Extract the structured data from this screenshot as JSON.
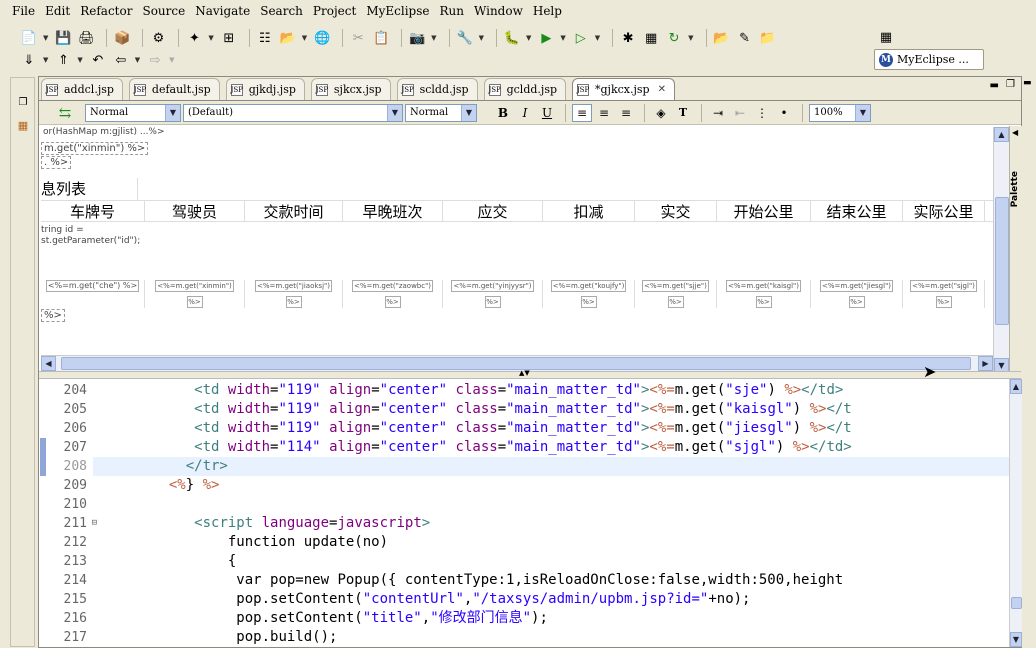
{
  "menu": [
    "File",
    "Edit",
    "Refactor",
    "Source",
    "Navigate",
    "Search",
    "Project",
    "MyEclipse",
    "Run",
    "Window",
    "Help"
  ],
  "perspective": {
    "label": "MyEclipse ...",
    "icon": "myeclipse-icon"
  },
  "tabs": [
    {
      "label": "addcl.jsp",
      "active": false
    },
    {
      "label": "default.jsp",
      "active": false
    },
    {
      "label": "gjkdj.jsp",
      "active": false
    },
    {
      "label": "sjkcx.jsp",
      "active": false
    },
    {
      "label": "scldd.jsp",
      "active": false
    },
    {
      "label": "gcldd.jsp",
      "active": false
    },
    {
      "label": "*gjkcx.jsp",
      "active": true
    }
  ],
  "format": {
    "paragraph": "Normal",
    "font": "(Default)",
    "size": "Normal",
    "zoom": "100%",
    "bold": "B",
    "italic": "I",
    "underline": "U"
  },
  "design": {
    "frag_top": "or(HashMap m:gjlist) ...%>",
    "frag_mget": "m.get(\"xinmin\") %>",
    "frag_pct": ". %>",
    "title": "息列表",
    "headers": [
      "车牌号",
      "驾驶员",
      "交款时间",
      "早晚班次",
      "应交",
      "扣减",
      "实交",
      "开始公里",
      "结束公里",
      "实际公里"
    ],
    "frag_string": "tring id =",
    "frag_param": "st.getParameter(\"id\");",
    "che_cell": "<%=m.get(\"che\") %>",
    "cells": [
      "<%=m.get(\"xinmin\")",
      "<%=m.get(\"jiaoksj\")",
      "<%=m.get(\"zaowbc\")",
      "<%=m.get(\"yinjyysr\")",
      "<%=m.get(\"koujfy\")",
      "<%=m.get(\"sjje\")",
      "<%=m.get(\"kaisgl\")",
      "<%=m.get(\"jiesgl\")",
      "<%=m.get(\"sjgl\")"
    ],
    "cell_close": "%>",
    "frag_bottom": "%>",
    "palette_label": "Palette"
  },
  "source": {
    "line_numbers": [
      "204",
      "205",
      "206",
      "207",
      "208",
      "209",
      "210",
      "211",
      "212",
      "213",
      "214",
      "215",
      "216",
      "217"
    ],
    "current_line": "208",
    "fold_line": "211",
    "lines": [
      {
        "indent": "            ",
        "parts": [
          [
            "tag",
            "<td "
          ],
          [
            "attr",
            "width"
          ],
          [
            "kw",
            "="
          ],
          [
            "str",
            "\"119\""
          ],
          [
            "kw",
            " "
          ],
          [
            "attr",
            "align"
          ],
          [
            "kw",
            "="
          ],
          [
            "str",
            "\"center\""
          ],
          [
            "kw",
            " "
          ],
          [
            "attr",
            "class"
          ],
          [
            "kw",
            "="
          ],
          [
            "str",
            "\"main_matter_td\""
          ],
          [
            "tag",
            ">"
          ],
          [
            "jsp",
            "<%="
          ],
          [
            "kw",
            "m.get("
          ],
          [
            "str",
            "\"sje\""
          ],
          [
            "kw",
            ") "
          ],
          [
            "jsp",
            "%>"
          ],
          [
            "tag",
            "</td>"
          ]
        ]
      },
      {
        "indent": "            ",
        "parts": [
          [
            "tag",
            "<td "
          ],
          [
            "attr",
            "width"
          ],
          [
            "kw",
            "="
          ],
          [
            "str",
            "\"119\""
          ],
          [
            "kw",
            " "
          ],
          [
            "attr",
            "align"
          ],
          [
            "kw",
            "="
          ],
          [
            "str",
            "\"center\""
          ],
          [
            "kw",
            " "
          ],
          [
            "attr",
            "class"
          ],
          [
            "kw",
            "="
          ],
          [
            "str",
            "\"main_matter_td\""
          ],
          [
            "tag",
            ">"
          ],
          [
            "jsp",
            "<%="
          ],
          [
            "kw",
            "m.get("
          ],
          [
            "str",
            "\"kaisgl\""
          ],
          [
            "kw",
            ") "
          ],
          [
            "jsp",
            "%>"
          ],
          [
            "tag",
            "</t"
          ]
        ]
      },
      {
        "indent": "            ",
        "parts": [
          [
            "tag",
            "<td "
          ],
          [
            "attr",
            "width"
          ],
          [
            "kw",
            "="
          ],
          [
            "str",
            "\"119\""
          ],
          [
            "kw",
            " "
          ],
          [
            "attr",
            "align"
          ],
          [
            "kw",
            "="
          ],
          [
            "str",
            "\"center\""
          ],
          [
            "kw",
            " "
          ],
          [
            "attr",
            "class"
          ],
          [
            "kw",
            "="
          ],
          [
            "str",
            "\"main_matter_td\""
          ],
          [
            "tag",
            ">"
          ],
          [
            "jsp",
            "<%="
          ],
          [
            "kw",
            "m.get("
          ],
          [
            "str",
            "\"jiesgl\""
          ],
          [
            "kw",
            ") "
          ],
          [
            "jsp",
            "%>"
          ],
          [
            "tag",
            "</t"
          ]
        ]
      },
      {
        "indent": "            ",
        "parts": [
          [
            "tag",
            "<td "
          ],
          [
            "attr",
            "width"
          ],
          [
            "kw",
            "="
          ],
          [
            "str",
            "\"114\""
          ],
          [
            "kw",
            " "
          ],
          [
            "attr",
            "align"
          ],
          [
            "kw",
            "="
          ],
          [
            "str",
            "\"center\""
          ],
          [
            "kw",
            " "
          ],
          [
            "attr",
            "class"
          ],
          [
            "kw",
            "="
          ],
          [
            "str",
            "\"main_matter_td\""
          ],
          [
            "tag",
            ">"
          ],
          [
            "jsp",
            "<%="
          ],
          [
            "kw",
            "m.get("
          ],
          [
            "str",
            "\"sjgl\""
          ],
          [
            "kw",
            ") "
          ],
          [
            "jsp",
            "%>"
          ],
          [
            "tag",
            "</td>"
          ]
        ]
      },
      {
        "indent": "           ",
        "parts": [
          [
            "tag",
            "</tr>"
          ]
        ]
      },
      {
        "indent": "         ",
        "parts": [
          [
            "jsp",
            "<%"
          ],
          [
            "kw",
            "} "
          ],
          [
            "jsp",
            "%>"
          ]
        ]
      },
      {
        "indent": "",
        "parts": []
      },
      {
        "indent": "            ",
        "parts": [
          [
            "tag",
            "<script "
          ],
          [
            "attr",
            "language"
          ],
          [
            "kw",
            "="
          ],
          [
            "attr",
            "javascript"
          ],
          [
            "tag",
            ">"
          ]
        ]
      },
      {
        "indent": "                ",
        "parts": [
          [
            "kw",
            "function update(no)"
          ]
        ]
      },
      {
        "indent": "                ",
        "parts": [
          [
            "kw",
            "{"
          ]
        ]
      },
      {
        "indent": "                 ",
        "parts": [
          [
            "kw",
            "var pop=new Popup({ contentType:1,isReloadOnClose:false,width:500,height"
          ]
        ]
      },
      {
        "indent": "                 ",
        "parts": [
          [
            "kw",
            "pop.setContent("
          ],
          [
            "str",
            "\"contentUrl\""
          ],
          [
            "kw",
            ","
          ],
          [
            "str",
            "\"/taxsys/admin/upbm.jsp?id=\""
          ],
          [
            "kw",
            "+no);"
          ]
        ]
      },
      {
        "indent": "                 ",
        "parts": [
          [
            "kw",
            "pop.setContent("
          ],
          [
            "str",
            "\"title\""
          ],
          [
            "kw",
            ","
          ],
          [
            "str",
            "\"修改部门信息\""
          ],
          [
            "kw",
            ");"
          ]
        ]
      },
      {
        "indent": "                 ",
        "parts": [
          [
            "kw",
            "pop.build();"
          ]
        ]
      }
    ]
  },
  "colors": {
    "tag": "#3f7f7f",
    "attr": "#7f007f",
    "string": "#2a00ff",
    "jsp": "#bf5f3f",
    "current_line": "#e8f2fe"
  }
}
